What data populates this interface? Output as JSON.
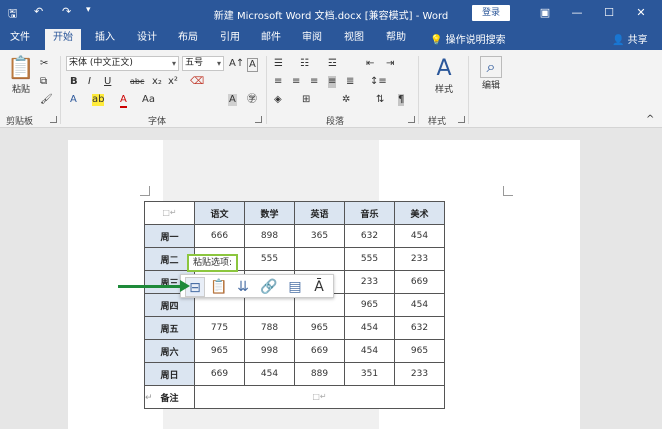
{
  "titlebar": {
    "title": "新建 Microsoft Word 文档.docx [兼容模式] - Word",
    "login_label": "登录",
    "save_icon": "save-icon",
    "undo_icon": "undo-icon",
    "redo_icon": "redo-icon",
    "customize_icon": "customize-icon"
  },
  "tabs": [
    "文件",
    "开始",
    "插入",
    "设计",
    "布局",
    "引用",
    "邮件",
    "审阅",
    "视图",
    "帮助"
  ],
  "tell_me": "操作说明搜索",
  "share": "共享",
  "ribbon": {
    "clipboard": {
      "label": "剪贴板",
      "paste": "粘贴"
    },
    "font": {
      "label": "字体",
      "font_name": "宋体 (中文正文)",
      "font_size": "五号",
      "buttons": [
        "B",
        "I",
        "U",
        "abc",
        "x₂",
        "x²",
        "A",
        "A",
        "Aa"
      ]
    },
    "paragraph": {
      "label": "段落"
    },
    "styles": {
      "label": "样式",
      "button": "样式"
    },
    "editing": {
      "button": "编辑"
    }
  },
  "table": {
    "corner": "",
    "columns": [
      "语文",
      "数学",
      "英语",
      "音乐",
      "美术"
    ],
    "rows": [
      {
        "label": "周一",
        "values": [
          "666",
          "898",
          "365",
          "632",
          "454"
        ]
      },
      {
        "label": "周二",
        "values": [
          "",
          "555",
          "",
          "555",
          "233"
        ]
      },
      {
        "label": "周三",
        "values": [
          "",
          "",
          "",
          "233",
          "669"
        ]
      },
      {
        "label": "周四",
        "values": [
          "",
          "",
          "",
          "965",
          "454"
        ]
      },
      {
        "label": "周五",
        "values": [
          "775",
          "788",
          "965",
          "454",
          "632"
        ]
      },
      {
        "label": "周六",
        "values": [
          "965",
          "998",
          "669",
          "454",
          "965"
        ]
      },
      {
        "label": "周日",
        "values": [
          "669",
          "454",
          "889",
          "351",
          "233"
        ]
      }
    ],
    "note_label": "备注"
  },
  "paste_options": {
    "label": "粘贴选项:",
    "buttons": [
      "nest-table-icon",
      "merge-table-icon",
      "insert-rows-icon",
      "keep-text-only-icon",
      "overwrite-cells-icon",
      "text-only-icon"
    ]
  },
  "colors": {
    "accent": "#2b579a",
    "highlight_border": "#8cc63f",
    "arrow": "#1e8a3a",
    "header_fill": "#dbe5f1"
  }
}
